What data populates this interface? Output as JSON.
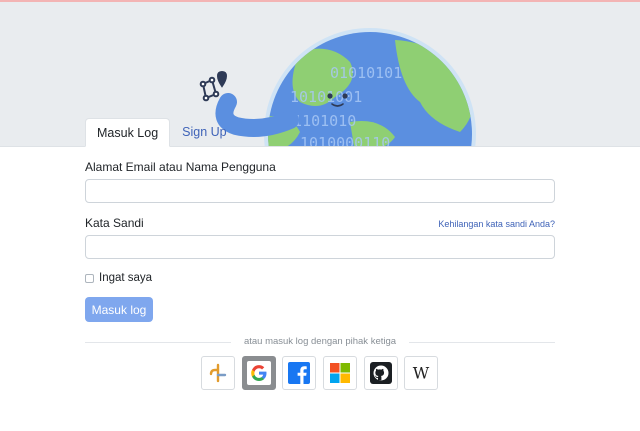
{
  "tabs": {
    "login": "Masuk Log",
    "signup": "Sign Up"
  },
  "form": {
    "email_label": "Alamat Email atau Nama Pengguna",
    "email_value": "",
    "password_label": "Kata Sandi",
    "password_value": "",
    "forgot_link": "Kehilangan kata sandi Anda?",
    "remember_label": "Ingat saya",
    "submit_label": "Masuk log"
  },
  "third_party": {
    "divider_text": "atau masuk log dengan pihak ketiga",
    "providers": [
      {
        "name": "openstreetmap-login",
        "icon": "osm-icon"
      },
      {
        "name": "google",
        "icon": "google-icon",
        "selected": true
      },
      {
        "name": "facebook",
        "icon": "facebook-icon"
      },
      {
        "name": "microsoft",
        "icon": "microsoft-icon"
      },
      {
        "name": "github",
        "icon": "github-icon"
      },
      {
        "name": "wikipedia",
        "icon": "wikipedia-icon"
      }
    ]
  },
  "colors": {
    "primary_button": "#7fa7ee",
    "link": "#3f63b8",
    "hero_bg": "#e9ecef"
  }
}
